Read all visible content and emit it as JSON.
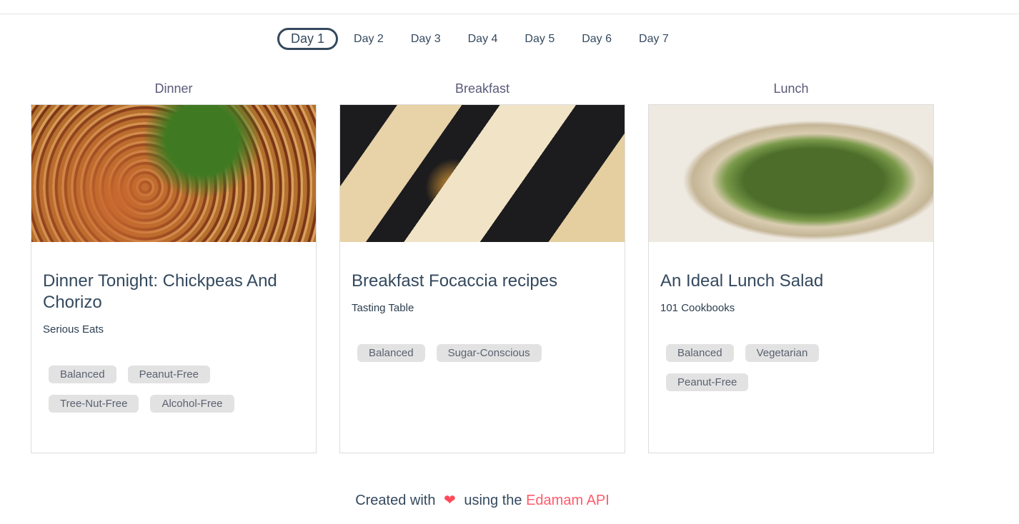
{
  "tabs": [
    "Day 1",
    "Day 2",
    "Day 3",
    "Day 4",
    "Day 5",
    "Day 6",
    "Day 7"
  ],
  "active_tab": "Day 1",
  "meals": [
    {
      "meal": "Dinner",
      "title": "Dinner Tonight: Chickpeas And Chorizo",
      "source": "Serious Eats",
      "tags": [
        "Balanced",
        "Peanut-Free",
        "Tree-Nut-Free",
        "Alcohol-Free"
      ]
    },
    {
      "meal": "Breakfast",
      "title": "Breakfast Focaccia recipes",
      "source": "Tasting Table",
      "tags": [
        "Balanced",
        "Sugar-Conscious"
      ]
    },
    {
      "meal": "Lunch",
      "title": "An Ideal Lunch Salad",
      "source": "101 Cookbooks",
      "tags": [
        "Balanced",
        "Vegetarian",
        "Peanut-Free"
      ]
    }
  ],
  "footer": {
    "prefix": "Created with",
    "icon": "heart-icon",
    "middle": "using the",
    "link": "Edamam API"
  },
  "colors": {
    "accent": "#34495e",
    "heart": "#ff4a5a",
    "link": "#ff5c6c"
  }
}
